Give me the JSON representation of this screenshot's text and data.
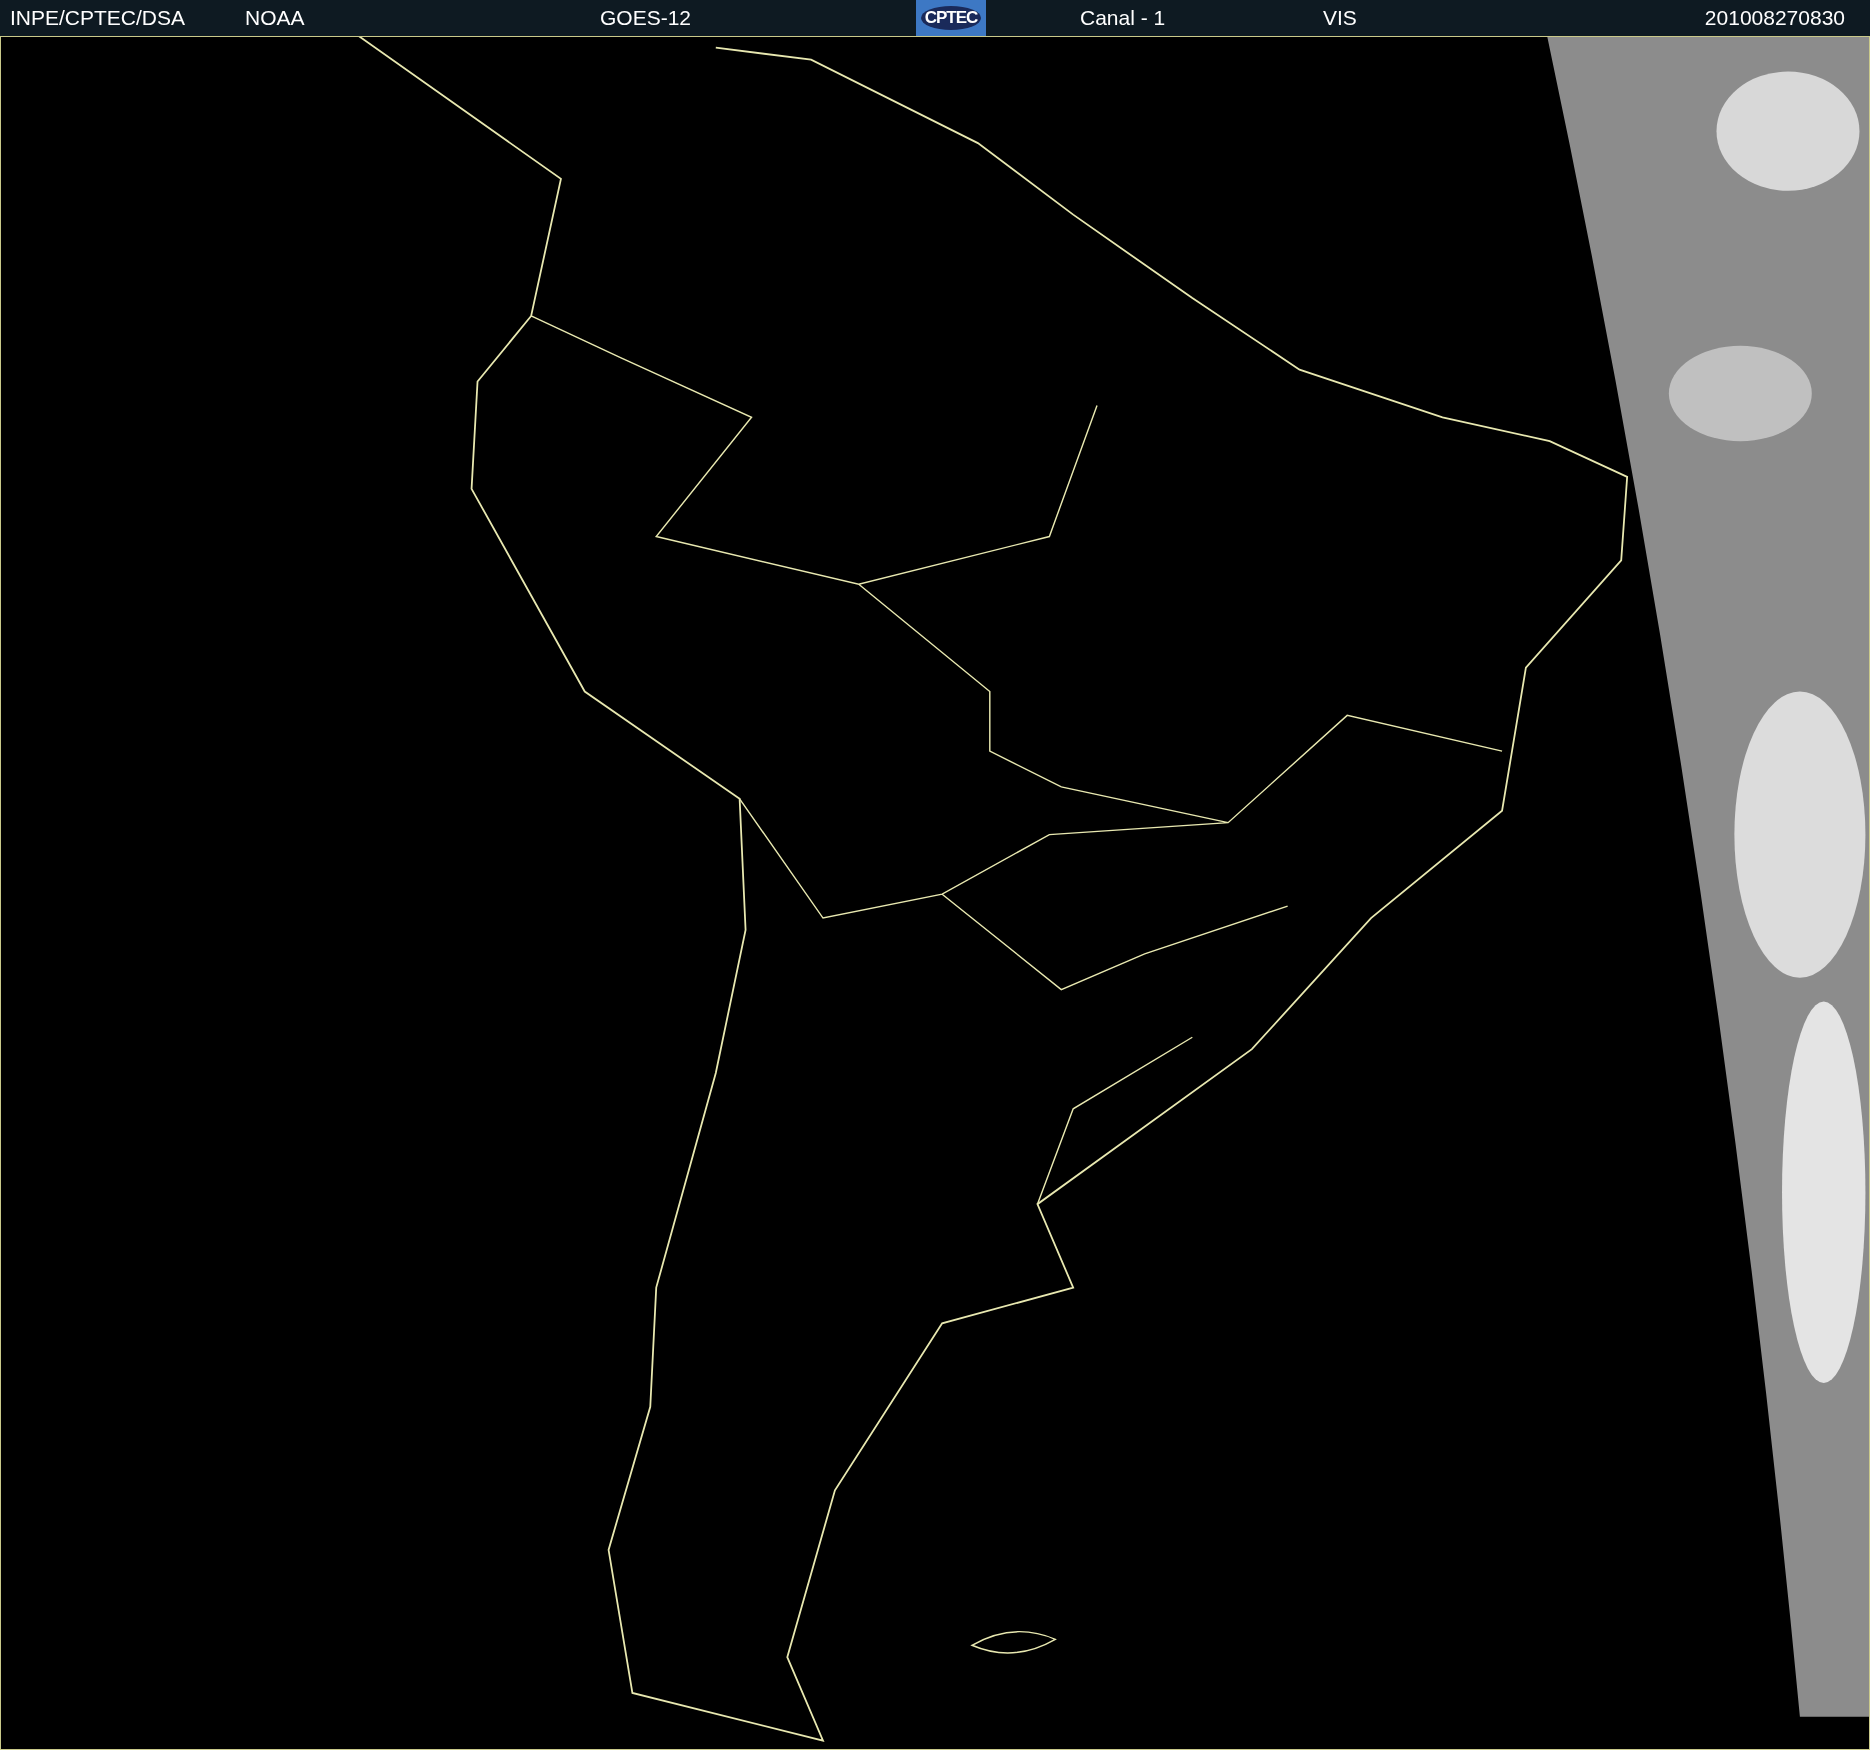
{
  "header": [
    {
      "kind": "text",
      "text": "INPE/CPTEC/DSA"
    },
    {
      "kind": "text",
      "text": "NOAA"
    },
    {
      "kind": "text",
      "text": "GOES-12"
    },
    {
      "kind": "logo",
      "text": "CPTEC"
    },
    {
      "kind": "text",
      "text": "Canal - 1"
    },
    {
      "kind": "text",
      "text": "VIS"
    },
    {
      "kind": "text",
      "text": "201008270830"
    }
  ]
}
